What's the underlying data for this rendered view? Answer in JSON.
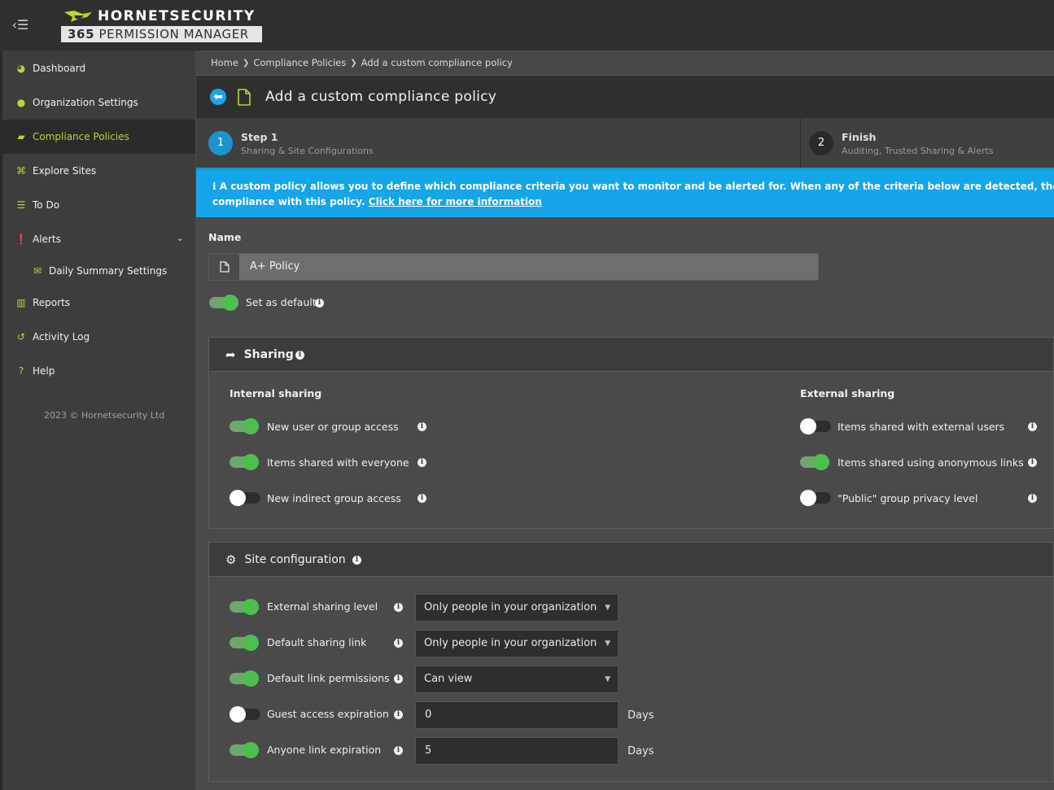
{
  "brand": {
    "name": "HORNETSECURITY",
    "product_number": "365",
    "product_name": "PERMISSION MANAGER",
    "accent_color": "#b8d435"
  },
  "sidebar": {
    "items": [
      {
        "label": "Dashboard",
        "icon": "dashboard-icon"
      },
      {
        "label": "Organization Settings",
        "icon": "globe-icon"
      },
      {
        "label": "Compliance Policies",
        "icon": "book-icon",
        "active": true
      },
      {
        "label": "Explore Sites",
        "icon": "binoculars-icon"
      },
      {
        "label": "To Do",
        "icon": "list-icon"
      },
      {
        "label": "Alerts",
        "icon": "alert-icon"
      },
      {
        "label": "Daily Summary Settings",
        "icon": "envelope-icon"
      },
      {
        "label": "Reports",
        "icon": "bar-chart-icon"
      },
      {
        "label": "Activity Log",
        "icon": "history-icon"
      },
      {
        "label": "Help",
        "icon": "help-icon"
      }
    ],
    "copyright": "2023 © Hornetsecurity Ltd"
  },
  "breadcrumb": [
    "Home",
    "Compliance Policies",
    "Add a custom compliance policy"
  ],
  "header": {
    "title": "Add a custom compliance policy"
  },
  "steps": [
    {
      "number": "1",
      "title": "Step 1",
      "subtitle": "Sharing & Site Configurations",
      "color": "#1a95cf"
    },
    {
      "number": "2",
      "title": "Finish",
      "subtitle": "Auditing, Trusted Sharing & Alerts",
      "color": "#2a2a2a"
    }
  ],
  "info_banner": {
    "text": "A custom policy allows you to define which compliance criteria you want to monitor and be alerted for. When any of the criteria below are detected, the sharing or site configu",
    "text2": "compliance with this policy.",
    "link": "Click here for more information"
  },
  "form": {
    "name_label": "Name",
    "name_value": "A+ Policy",
    "default_label": "Set as default",
    "default_on": true
  },
  "sharing": {
    "title": "Sharing",
    "internal_title": "Internal sharing",
    "external_title": "External sharing",
    "internal": [
      {
        "label": "New user or group access",
        "on": true
      },
      {
        "label": "Items shared with everyone",
        "on": true
      },
      {
        "label": "New indirect group access",
        "on": false
      }
    ],
    "external": [
      {
        "label": "Items shared with external users",
        "on": false
      },
      {
        "label": "Items shared using anonymous links",
        "on": true
      },
      {
        "label": "\"Public\" group privacy level",
        "on": false
      }
    ]
  },
  "site_config": {
    "title": "Site configuration",
    "rows": [
      {
        "label": "External sharing level",
        "on": true,
        "value": "Only people in your organization",
        "kind": "select"
      },
      {
        "label": "Default sharing link",
        "on": true,
        "value": "Only people in your organization",
        "kind": "select"
      },
      {
        "label": "Default link permissions",
        "on": true,
        "value": "Can view",
        "kind": "select"
      },
      {
        "label": "Guest access expiration",
        "on": false,
        "value": "0",
        "kind": "number",
        "unit": "Days"
      },
      {
        "label": "Anyone link expiration",
        "on": true,
        "value": "5",
        "kind": "number",
        "unit": "Days"
      }
    ]
  }
}
